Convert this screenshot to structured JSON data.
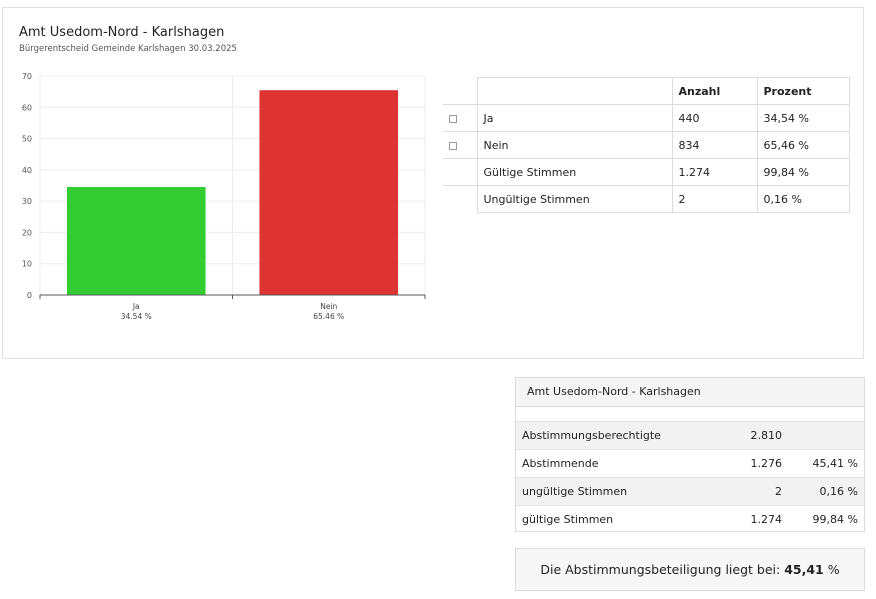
{
  "panel": {
    "title": "Amt Usedom-Nord - Karlshagen",
    "subtitle": "Bürgerentscheid Gemeinde Karlshagen 30.03.2025"
  },
  "chart_data": {
    "type": "bar",
    "categories": [
      "Ja",
      "Nein"
    ],
    "category_labels": [
      "34.54 %",
      "65.46 %"
    ],
    "values": [
      34.54,
      65.46
    ],
    "colors": [
      "#33cc33",
      "#dd3333"
    ],
    "ylim": [
      0,
      70
    ],
    "yticks": [
      0,
      10,
      20,
      30,
      40,
      50,
      60,
      70
    ],
    "grid": true,
    "title": "",
    "xlabel": "",
    "ylabel": ""
  },
  "results_table": {
    "headers": {
      "count": "Anzahl",
      "percent": "Prozent"
    },
    "rows": [
      {
        "marker": true,
        "name": "Ja",
        "count": "440",
        "percent": "34,54 %"
      },
      {
        "marker": true,
        "name": "Nein",
        "count": "834",
        "percent": "65,46 %"
      },
      {
        "marker": false,
        "name": "Gültige Stimmen",
        "count": "1.274",
        "percent": "99,84 %"
      },
      {
        "marker": false,
        "name": "Ungültige Stimmen",
        "count": "2",
        "percent": "0,16 %"
      }
    ]
  },
  "summary": {
    "title": "Amt Usedom-Nord - Karlshagen",
    "rows": [
      {
        "label": "Abstimmungsberechtigte",
        "value": "2.810",
        "percent": ""
      },
      {
        "label": "Abstimmende",
        "value": "1.276",
        "percent": "45,41 %"
      },
      {
        "label": "ungültige Stimmen",
        "value": "2",
        "percent": "0,16 %"
      },
      {
        "label": "gültige Stimmen",
        "value": "1.274",
        "percent": "99,84 %"
      }
    ]
  },
  "turnout": {
    "text": "Die Abstimmungsbeteiligung liegt bei:",
    "value": "45,41",
    "unit": "%"
  }
}
